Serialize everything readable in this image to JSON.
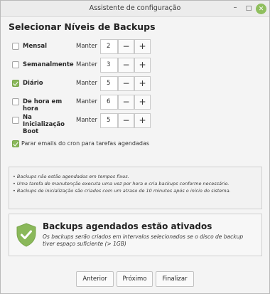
{
  "window": {
    "title": "Assistente de configuração",
    "minimize_glyph": "–",
    "maximize_glyph": "□",
    "close_glyph": "✕"
  },
  "heading": "Selecionar Níveis de Backups",
  "keep_label": "Manter",
  "levels": [
    {
      "label": "Mensal",
      "checked": false,
      "value": "2"
    },
    {
      "label": "Semanalmente",
      "checked": false,
      "value": "3"
    },
    {
      "label": "Diário",
      "checked": true,
      "value": "5"
    },
    {
      "label": "De hora em hora",
      "checked": false,
      "value": "6"
    },
    {
      "label": "Na Inicialização Boot",
      "checked": false,
      "value": "5"
    }
  ],
  "spin": {
    "minus": "−",
    "plus": "+"
  },
  "cron": {
    "label": "Parar emails do cron para tarefas agendadas",
    "checked": true
  },
  "info_lines": [
    "• Backups não estão agendados em tempos fixos.",
    "• Uma tarefa de manutenção executa uma vez por hora e cria backups conforme necessário.",
    "• Backups de inicialização são criados com um atraso de 10 minutos após o início do sistema."
  ],
  "status": {
    "icon": "shield-check-icon",
    "title": "Backups agendados estão ativados",
    "description": "Os backups serão criados em intervalos selecionados se o disco de backup tiver espaço suficiente (> 1GB)",
    "color": "#8ab85a"
  },
  "footer": {
    "back": "Anterior",
    "next": "Próximo",
    "finish": "Finalizar"
  }
}
